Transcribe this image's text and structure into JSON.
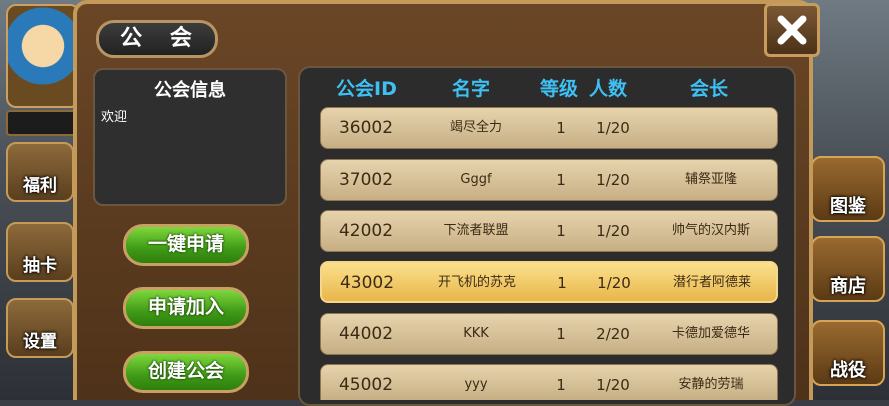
{
  "sidebar_left": {
    "buttons": [
      {
        "label": "福利",
        "icon": "gift-icon"
      },
      {
        "label": "抽卡",
        "icon": "card-icon"
      },
      {
        "label": "设置",
        "icon": "gear-icon"
      }
    ]
  },
  "sidebar_right": {
    "buttons": [
      {
        "label": "图鉴",
        "icon": "book-icon"
      },
      {
        "label": "商店",
        "icon": "shop-icon"
      },
      {
        "label": "战役",
        "icon": "swords-icon"
      }
    ]
  },
  "panel": {
    "title": "公 会",
    "info": {
      "title": "公会信息",
      "text": "欢迎"
    },
    "buttons": {
      "quick_apply": "一键申请",
      "apply_join": "申请加入",
      "create": "创建公会"
    }
  },
  "table": {
    "headers": {
      "id": "公会ID",
      "name": "名字",
      "level": "等级",
      "count": "人数",
      "leader": "会长"
    },
    "rows": [
      {
        "id": "36002",
        "name": "竭尽全力",
        "level": "1",
        "count": "1/20",
        "leader": "",
        "selected": false
      },
      {
        "id": "37002",
        "name": "Gggf",
        "level": "1",
        "count": "1/20",
        "leader": "辅祭亚隆",
        "selected": false
      },
      {
        "id": "42002",
        "name": "下流者联盟",
        "level": "1",
        "count": "1/20",
        "leader": "帅气的汉内斯",
        "selected": false
      },
      {
        "id": "43002",
        "name": "开飞机的苏克",
        "level": "1",
        "count": "1/20",
        "leader": "潜行者阿德莱",
        "selected": true
      },
      {
        "id": "44002",
        "name": "KKK",
        "level": "1",
        "count": "2/20",
        "leader": "卡德加爱德华",
        "selected": false
      },
      {
        "id": "45002",
        "name": "yyy",
        "level": "1",
        "count": "1/20",
        "leader": "安静的劳瑞",
        "selected": false
      }
    ]
  }
}
